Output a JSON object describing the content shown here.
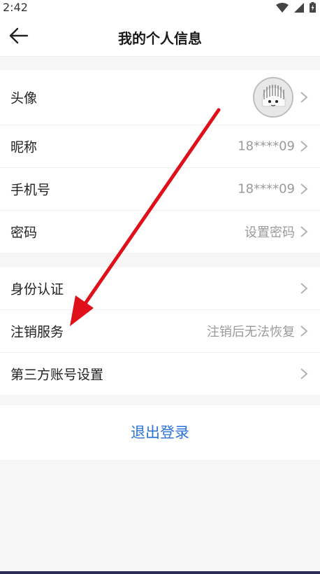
{
  "status_bar": {
    "time": "2:42"
  },
  "nav": {
    "title": "我的个人信息"
  },
  "profile_group": {
    "avatar_label": "头像",
    "nickname_label": "昵称",
    "nickname_value": "18****09",
    "phone_label": "手机号",
    "phone_value": "18****09",
    "password_label": "密码",
    "password_value": "设置密码"
  },
  "account_group": {
    "identity_label": "身份认证",
    "cancel_label": "注销服务",
    "cancel_value": "注销后无法恢复",
    "third_party_label": "第三方账号设置"
  },
  "logout_label": "退出登录",
  "colors": {
    "accent": "#2a73d9",
    "secondary_text": "#9a9a9a",
    "background": "#f6f6f6",
    "annotation_arrow": "#e0101a"
  },
  "icons": [
    "wifi-icon",
    "signal-icon",
    "battery-icon",
    "back-arrow-icon",
    "chevron-right-icon",
    "avatar-image"
  ]
}
